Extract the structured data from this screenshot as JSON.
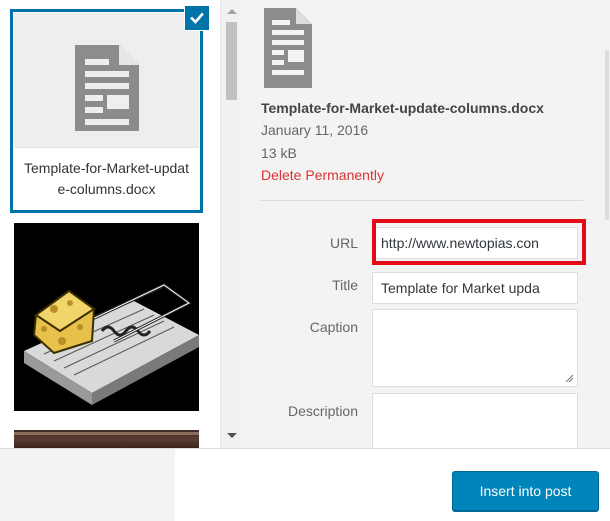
{
  "media_grid": {
    "selected_file": {
      "caption": "Template-for-Market-update-columns.docx",
      "icon": "document-icon"
    },
    "attachments": [
      {
        "type": "image",
        "subject": "mousetrap with cheese"
      },
      {
        "type": "image",
        "subject": "partially visible image"
      }
    ]
  },
  "details": {
    "icon": "document-icon",
    "filename": "Template-for-Market-update-columns.docx",
    "date": "January 11, 2016",
    "size": "13 kB",
    "delete_label": "Delete Permanently",
    "fields": {
      "url_label": "URL",
      "url_value": "http://www.newtopias.con",
      "title_label": "Title",
      "title_value": "Template for Market upda",
      "caption_label": "Caption",
      "caption_value": "",
      "description_label": "Description",
      "description_value": ""
    }
  },
  "toolbar": {
    "insert_label": "Insert into post"
  },
  "colors": {
    "selection": "#0073aa",
    "delete": "#dc3232",
    "highlight": "#e30b17",
    "primary_button": "#0085ba"
  }
}
